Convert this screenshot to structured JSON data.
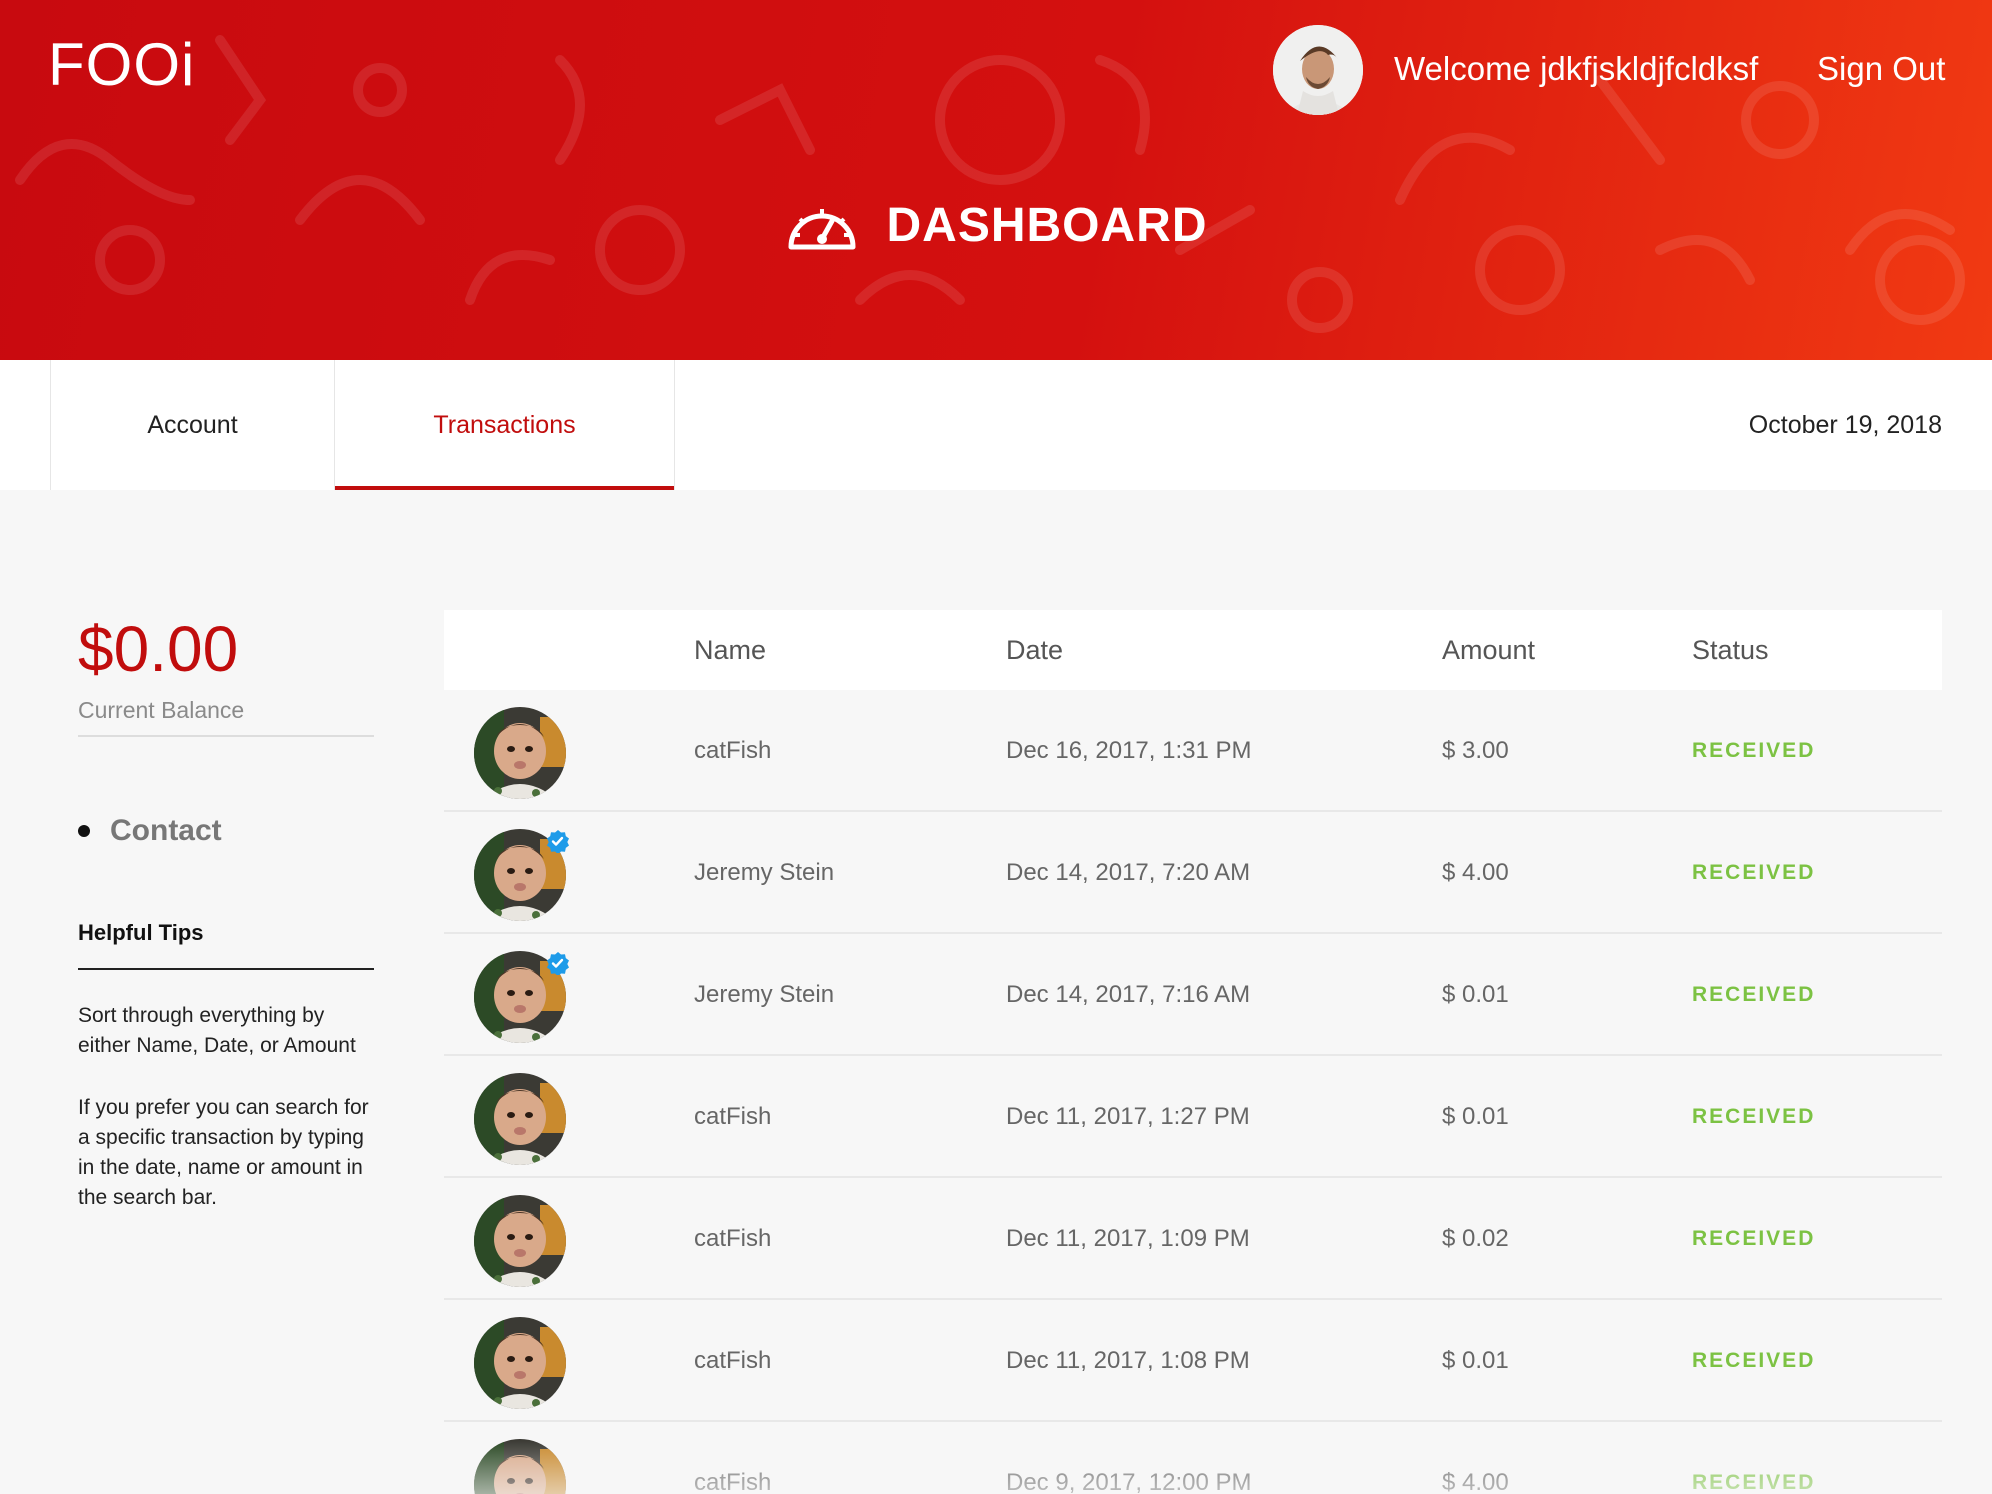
{
  "header": {
    "logo": "FOOi",
    "welcome": "Welcome jdkfjskldjfcldksf",
    "sign_out": "Sign Out",
    "title": "DASHBOARD"
  },
  "tabs": {
    "account": "Account",
    "transactions": "Transactions",
    "active": "Transactions",
    "date": "October 19, 2018"
  },
  "sidebar": {
    "balance": "$0.00",
    "balance_label": "Current Balance",
    "contact": "Contact",
    "tips_title": "Helpful Tips",
    "tip1": "Sort through everything by either Name, Date, or Amount",
    "tip2": "If you prefer you can search for a specific transaction by typing in the date, name or amount in the search bar."
  },
  "table": {
    "columns": [
      "Name",
      "Date",
      "Amount",
      "Status"
    ],
    "rows": [
      {
        "name": "catFish",
        "date": "Dec 16, 2017, 1:31 PM",
        "amount": "$ 3.00",
        "status": "RECEIVED",
        "verified": false
      },
      {
        "name": "Jeremy Stein",
        "date": "Dec 14, 2017, 7:20 AM",
        "amount": "$ 4.00",
        "status": "RECEIVED",
        "verified": true
      },
      {
        "name": "Jeremy Stein",
        "date": "Dec 14, 2017, 7:16 AM",
        "amount": "$ 0.01",
        "status": "RECEIVED",
        "verified": true
      },
      {
        "name": "catFish",
        "date": "Dec 11, 2017, 1:27 PM",
        "amount": "$ 0.01",
        "status": "RECEIVED",
        "verified": false
      },
      {
        "name": "catFish",
        "date": "Dec 11, 2017, 1:09 PM",
        "amount": "$ 0.02",
        "status": "RECEIVED",
        "verified": false
      },
      {
        "name": "catFish",
        "date": "Dec 11, 2017, 1:08 PM",
        "amount": "$ 0.01",
        "status": "RECEIVED",
        "verified": false
      },
      {
        "name": "catFish",
        "date": "Dec 9, 2017, 12:00 PM",
        "amount": "$ 4.00",
        "status": "RECEIVED",
        "verified": false
      }
    ]
  },
  "colors": {
    "brand_red": "#c10d0d",
    "status_green": "#7cc243",
    "verified_blue": "#1e9be9"
  },
  "icons": {
    "dashboard": "speedometer-icon",
    "verified": "verified-badge-icon"
  }
}
